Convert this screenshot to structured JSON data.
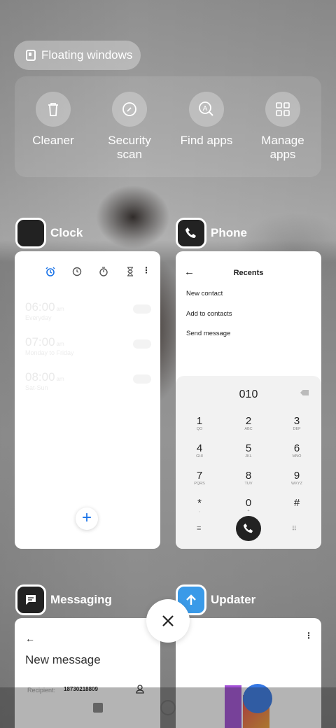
{
  "floating": {
    "label": "Floating windows",
    "icon": "floating-window-icon"
  },
  "tools": [
    {
      "label": "Cleaner",
      "icon": "trash-icon"
    },
    {
      "label": "Security\nscan",
      "line1": "Security",
      "line2": "scan",
      "icon": "security-scan-icon"
    },
    {
      "label": "Find apps",
      "icon": "find-apps-icon"
    },
    {
      "label": "Manage\napps",
      "line1": "Manage",
      "line2": "apps",
      "icon": "grid-icon"
    }
  ],
  "cards": {
    "clock": {
      "title": "Clock",
      "alarms": [
        {
          "time": "06:00",
          "ampm": "am",
          "repeat": "Everyday"
        },
        {
          "time": "07:00",
          "ampm": "am",
          "repeat": "Monday to Friday"
        },
        {
          "time": "08:00",
          "ampm": "am",
          "repeat": "Sat-Sun"
        }
      ],
      "fab": "+"
    },
    "phone": {
      "title": "Phone",
      "header": "Recents",
      "items": [
        "New contact",
        "Add to contacts",
        "Send message"
      ],
      "dialed": "010",
      "keys": [
        {
          "d": "1",
          "l": "QO"
        },
        {
          "d": "2",
          "l": "ABC"
        },
        {
          "d": "3",
          "l": "DEF"
        },
        {
          "d": "4",
          "l": "GHI"
        },
        {
          "d": "5",
          "l": "JKL"
        },
        {
          "d": "6",
          "l": "MNO"
        },
        {
          "d": "7",
          "l": "PQRS"
        },
        {
          "d": "8",
          "l": "TUV"
        },
        {
          "d": "9",
          "l": "WXYZ"
        },
        {
          "d": "*",
          "l": ","
        },
        {
          "d": "0",
          "l": "+"
        },
        {
          "d": "#",
          "l": ""
        }
      ]
    },
    "messaging": {
      "title": "Messaging",
      "heading": "New message",
      "recipient_label": "Recipient:",
      "recipient_value": "18730218809"
    },
    "updater": {
      "title": "Updater"
    }
  },
  "colors": {
    "accent": "#1a73e8",
    "updater": "#3a9ae8"
  }
}
